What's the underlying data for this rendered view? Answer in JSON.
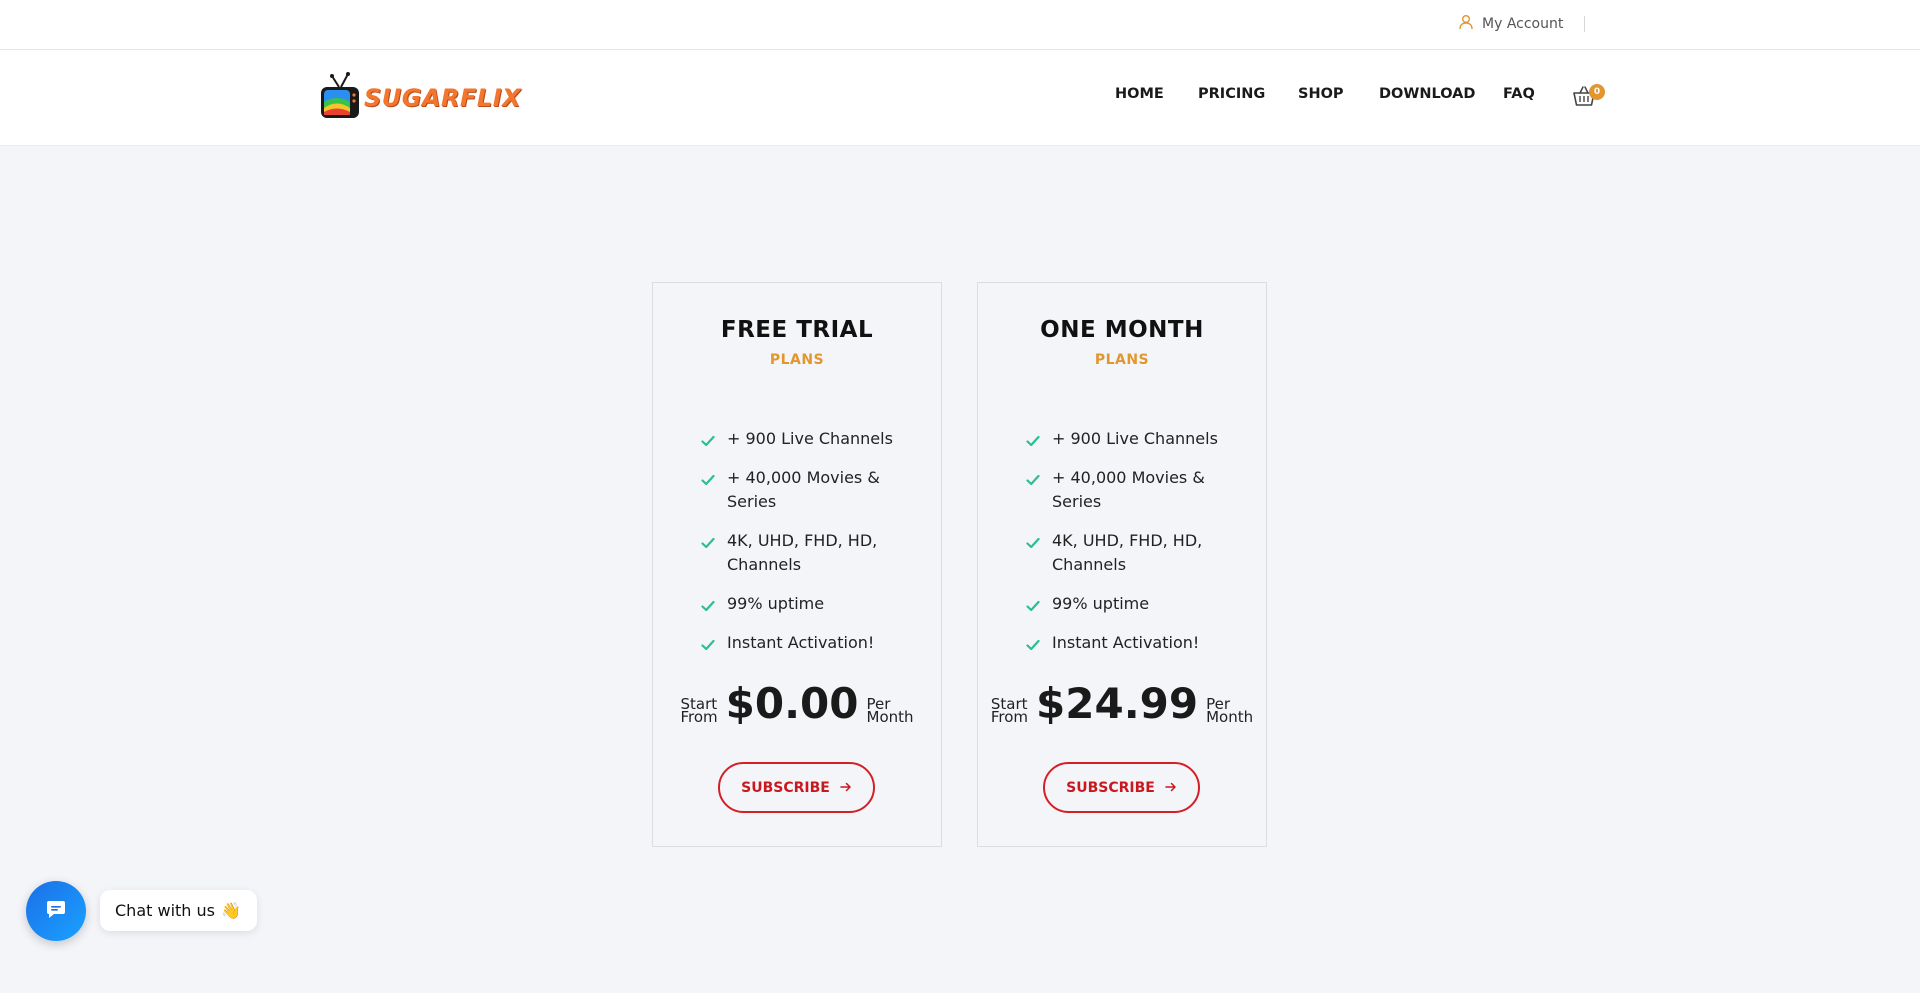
{
  "topbar": {
    "account_label": "My Account",
    "account_icon": "user-icon"
  },
  "header": {
    "logo_text": "SUGARFLIX",
    "logo_icon": "tv-icon",
    "nav": [
      {
        "label": "HOME"
      },
      {
        "label": "PRICING"
      },
      {
        "label": "SHOP"
      },
      {
        "label": "DOWNLOAD"
      },
      {
        "label": "FAQ"
      }
    ],
    "cart_icon": "basket-icon",
    "cart_count": "0"
  },
  "plans": [
    {
      "title": "FREE TRIAL",
      "subtitle": "PLANS",
      "features": [
        "+ 900 Live Channels",
        "+ 40,000 Movies & Series",
        "4K, UHD, FHD, HD, Channels",
        "99% uptime",
        "Instant Activation!"
      ],
      "price_prefix_1": "Start",
      "price_prefix_2": "From",
      "price": "$0.00",
      "price_suffix_1": "Per",
      "price_suffix_2": "Month",
      "button_label": "SUBSCRIBE"
    },
    {
      "title": "ONE MONTH",
      "subtitle": "PLANS",
      "features": [
        "+ 900 Live Channels",
        "+ 40,000 Movies & Series",
        "4K, UHD, FHD, HD, Channels",
        "99% uptime",
        "Instant Activation!"
      ],
      "price_prefix_1": "Start",
      "price_prefix_2": "From",
      "price": "$24.99",
      "price_suffix_1": "Per",
      "price_suffix_2": "Month",
      "button_label": "SUBSCRIBE"
    }
  ],
  "chat": {
    "label": "Chat with us",
    "emoji": "👋",
    "icon": "chat-icon"
  },
  "colors": {
    "accent": "#e2962f",
    "button": "#d41f26",
    "check": "#2bbf8f",
    "chat": "#1b6fe8"
  }
}
